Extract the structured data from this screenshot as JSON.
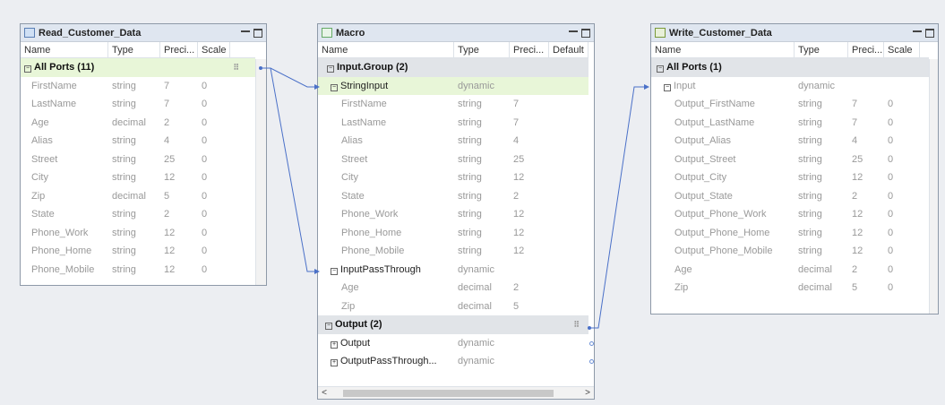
{
  "read_panel": {
    "title": "Read_Customer_Data",
    "columns": [
      "Name",
      "Type",
      "Preci...",
      "Scale"
    ],
    "group": {
      "label": "All Ports (11)"
    },
    "rows": [
      {
        "name": "FirstName",
        "type": "string",
        "prec": "7",
        "scale": "0"
      },
      {
        "name": "LastName",
        "type": "string",
        "prec": "7",
        "scale": "0"
      },
      {
        "name": "Age",
        "type": "decimal",
        "prec": "2",
        "scale": "0"
      },
      {
        "name": "Alias",
        "type": "string",
        "prec": "4",
        "scale": "0"
      },
      {
        "name": "Street",
        "type": "string",
        "prec": "25",
        "scale": "0"
      },
      {
        "name": "City",
        "type": "string",
        "prec": "12",
        "scale": "0"
      },
      {
        "name": "Zip",
        "type": "decimal",
        "prec": "5",
        "scale": "0"
      },
      {
        "name": "State",
        "type": "string",
        "prec": "2",
        "scale": "0"
      },
      {
        "name": "Phone_Work",
        "type": "string",
        "prec": "12",
        "scale": "0"
      },
      {
        "name": "Phone_Home",
        "type": "string",
        "prec": "12",
        "scale": "0"
      },
      {
        "name": "Phone_Mobile",
        "type": "string",
        "prec": "12",
        "scale": "0"
      }
    ]
  },
  "macro_panel": {
    "title": "Macro",
    "columns": [
      "Name",
      "Type",
      "Preci...",
      "Default"
    ],
    "input_group": {
      "label": "Input.Group (2)"
    },
    "string_input": {
      "name": "StringInput",
      "type": "dynamic"
    },
    "string_rows": [
      {
        "name": "FirstName",
        "type": "string",
        "prec": "7"
      },
      {
        "name": "LastName",
        "type": "string",
        "prec": "7"
      },
      {
        "name": "Alias",
        "type": "string",
        "prec": "4"
      },
      {
        "name": "Street",
        "type": "string",
        "prec": "25"
      },
      {
        "name": "City",
        "type": "string",
        "prec": "12"
      },
      {
        "name": "State",
        "type": "string",
        "prec": "2"
      },
      {
        "name": "Phone_Work",
        "type": "string",
        "prec": "12"
      },
      {
        "name": "Phone_Home",
        "type": "string",
        "prec": "12"
      },
      {
        "name": "Phone_Mobile",
        "type": "string",
        "prec": "12"
      }
    ],
    "pass_through": {
      "name": "InputPassThrough",
      "type": "dynamic"
    },
    "pass_rows": [
      {
        "name": "Age",
        "type": "decimal",
        "prec": "2"
      },
      {
        "name": "Zip",
        "type": "decimal",
        "prec": "5"
      }
    ],
    "output_group": {
      "label": "Output (2)"
    },
    "output_rows": [
      {
        "name": "Output",
        "type": "dynamic"
      },
      {
        "name": "OutputPassThrough...",
        "type": "dynamic"
      }
    ],
    "scroll_left": "<",
    "scroll_right": ">"
  },
  "write_panel": {
    "title": "Write_Customer_Data",
    "columns": [
      "Name",
      "Type",
      "Preci...",
      "Scale"
    ],
    "group": {
      "label": "All Ports (1)"
    },
    "input": {
      "name": "Input",
      "type": "dynamic"
    },
    "rows": [
      {
        "name": "Output_FirstName",
        "type": "string",
        "prec": "7",
        "scale": "0"
      },
      {
        "name": "Output_LastName",
        "type": "string",
        "prec": "7",
        "scale": "0"
      },
      {
        "name": "Output_Alias",
        "type": "string",
        "prec": "4",
        "scale": "0"
      },
      {
        "name": "Output_Street",
        "type": "string",
        "prec": "25",
        "scale": "0"
      },
      {
        "name": "Output_City",
        "type": "string",
        "prec": "12",
        "scale": "0"
      },
      {
        "name": "Output_State",
        "type": "string",
        "prec": "2",
        "scale": "0"
      },
      {
        "name": "Output_Phone_Work",
        "type": "string",
        "prec": "12",
        "scale": "0"
      },
      {
        "name": "Output_Phone_Home",
        "type": "string",
        "prec": "12",
        "scale": "0"
      },
      {
        "name": "Output_Phone_Mobile",
        "type": "string",
        "prec": "12",
        "scale": "0"
      },
      {
        "name": "Age",
        "type": "decimal",
        "prec": "2",
        "scale": "0"
      },
      {
        "name": "Zip",
        "type": "decimal",
        "prec": "5",
        "scale": "0"
      }
    ]
  },
  "icons": {
    "read": "table-source-icon",
    "macro": "macro-icon",
    "write": "table-target-icon",
    "minimize": "minimize-icon",
    "maximize": "maximize-icon"
  },
  "colors": {
    "link": "#4a70c8",
    "header_bg": "#dfe6f0",
    "highlight": "#e8f6d8",
    "group_bg": "#e1e4e8"
  }
}
